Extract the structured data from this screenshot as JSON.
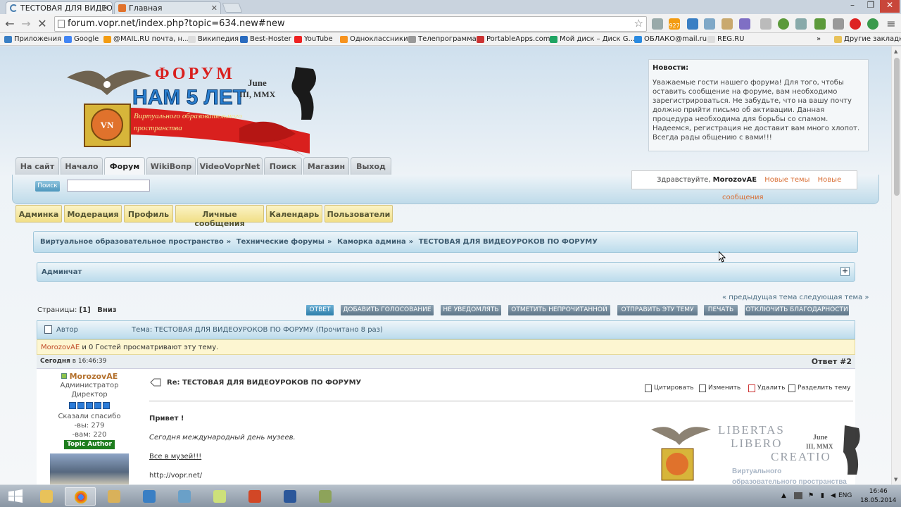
{
  "browser": {
    "tabs": [
      {
        "title": "ТЕСТОВАЯ ДЛЯ ВИДЕОУ",
        "active": true
      },
      {
        "title": "Главная",
        "active": false
      }
    ],
    "url": "forum.vopr.net/index.php?topic=634.new#new",
    "bookmarks": [
      "Приложения",
      "Google",
      "@MAIL.RU почта, н...",
      "Википедия",
      "Best-Hoster",
      "YouTube",
      "Одноклассники",
      "Телепрограмма",
      "PortableApps.com",
      "Мой диск – Диск G...",
      "ОБЛАКО@mail.ru",
      "REG.RU"
    ],
    "bookmarks_overflow": "»",
    "other_bookmarks": "Другие закладки",
    "mail_badge": "927"
  },
  "header": {
    "logo": {
      "line1": "ФОРУМ",
      "line2": "НАМ 5 ЛЕТ",
      "date1": "June",
      "date2": "III, MMX",
      "ribbon1": "Виртуального образовательного",
      "ribbon2": "пространства",
      "monogram": "VN"
    },
    "news_title": "Новости:",
    "news_text": "Уважаемые гости нашего форума! Для того, чтобы оставить сообщение на форуме, вам необходимо зарегистрироваться. Не забудьте, что на вашу почту должно прийти письмо об активации. Данная процедура необходима для борьбы со спамом. Надеемся, регистрация не доставит вам много хлопот. Всегда рады общению с вами!!!"
  },
  "main_tabs": [
    "На сайт",
    "Начало",
    "Форум",
    "WikiВопр",
    "VideoVoprNet",
    "Поиск",
    "Магазин",
    "Выход"
  ],
  "active_tab": "Форум",
  "search": {
    "button": "Поиск",
    "value": ""
  },
  "user": {
    "greeting": "Здравствуйте,",
    "name": "MorozovAE",
    "new_topics": "Новые темы",
    "new_messages_1": "Новые",
    "new_messages_2": "сообщения"
  },
  "sub_tabs": [
    "Админка",
    "Модерация",
    "Профиль",
    "Личные сообщения",
    "Календарь",
    "Пользователи"
  ],
  "breadcrumb": [
    "Виртуальное образовательное пространство",
    "Технические форумы",
    "Каморка админа",
    "ТЕСТОВАЯ ДЛЯ ВИДЕОУРОКОВ ПО ФОРУМУ"
  ],
  "breadcrumb_sep": "»",
  "adminchat": "Админчат",
  "topic_nav": "« предыдущая тема следующая тема »",
  "pages": {
    "label": "Страницы:",
    "current": "[1]",
    "down": "Вниз"
  },
  "actions": [
    "ОТВЕТ",
    "ДОБАВИТЬ ГОЛОСОВАНИЕ",
    "НЕ УВЕДОМЛЯТЬ",
    "ОТМЕТИТЬ НЕПРОЧИТАННОЙ",
    "ОТПРАВИТЬ ЭТУ ТЕМУ",
    "ПЕЧАТЬ",
    "ОТКЛЮЧИТЬ БЛАГОДАРНОСТИ"
  ],
  "topic_header": {
    "author_col": "Автор",
    "topic": "Тема: ТЕСТОВАЯ ДЛЯ ВИДЕОУРОКОВ ПО ФОРУМУ  (Прочитано 8 раз)"
  },
  "viewers": {
    "user": "MorozovAE",
    "rest": " и 0 Гостей просматривают эту тему."
  },
  "post": {
    "date_prefix": "Сегодня",
    "date_rest": " в 16:46:39",
    "number": "Ответ #2",
    "author": "MorozovAE",
    "role1": "Администратор",
    "role2": "Директор",
    "stars": 5,
    "thanks_label": "Сказали спасибо",
    "thanks_you": "-вы: 279",
    "thanks_them": "-вам: 220",
    "badge": "Topic Author",
    "title": "Re: ТЕСТОВАЯ ДЛЯ ВИДЕОУРОКОВ ПО ФОРУМУ",
    "tools": [
      "Цитировать",
      "Изменить",
      "Удалить",
      "Разделить тему"
    ],
    "lines": [
      "Привет !",
      "Сегодня международный день музеев.",
      "Все в музей!!!",
      "http://vopr.net/"
    ]
  },
  "watermark": {
    "line1": "LIBERTAS",
    "line2": "LIBERO",
    "line3": "CREATIO",
    "date1": "June",
    "date2": "III, MMX",
    "sub1": "Виртуального",
    "sub2": "образовательного пространства"
  },
  "taskbar": {
    "lang": "ENG",
    "time": "16:46",
    "date": "18.05.2014"
  }
}
